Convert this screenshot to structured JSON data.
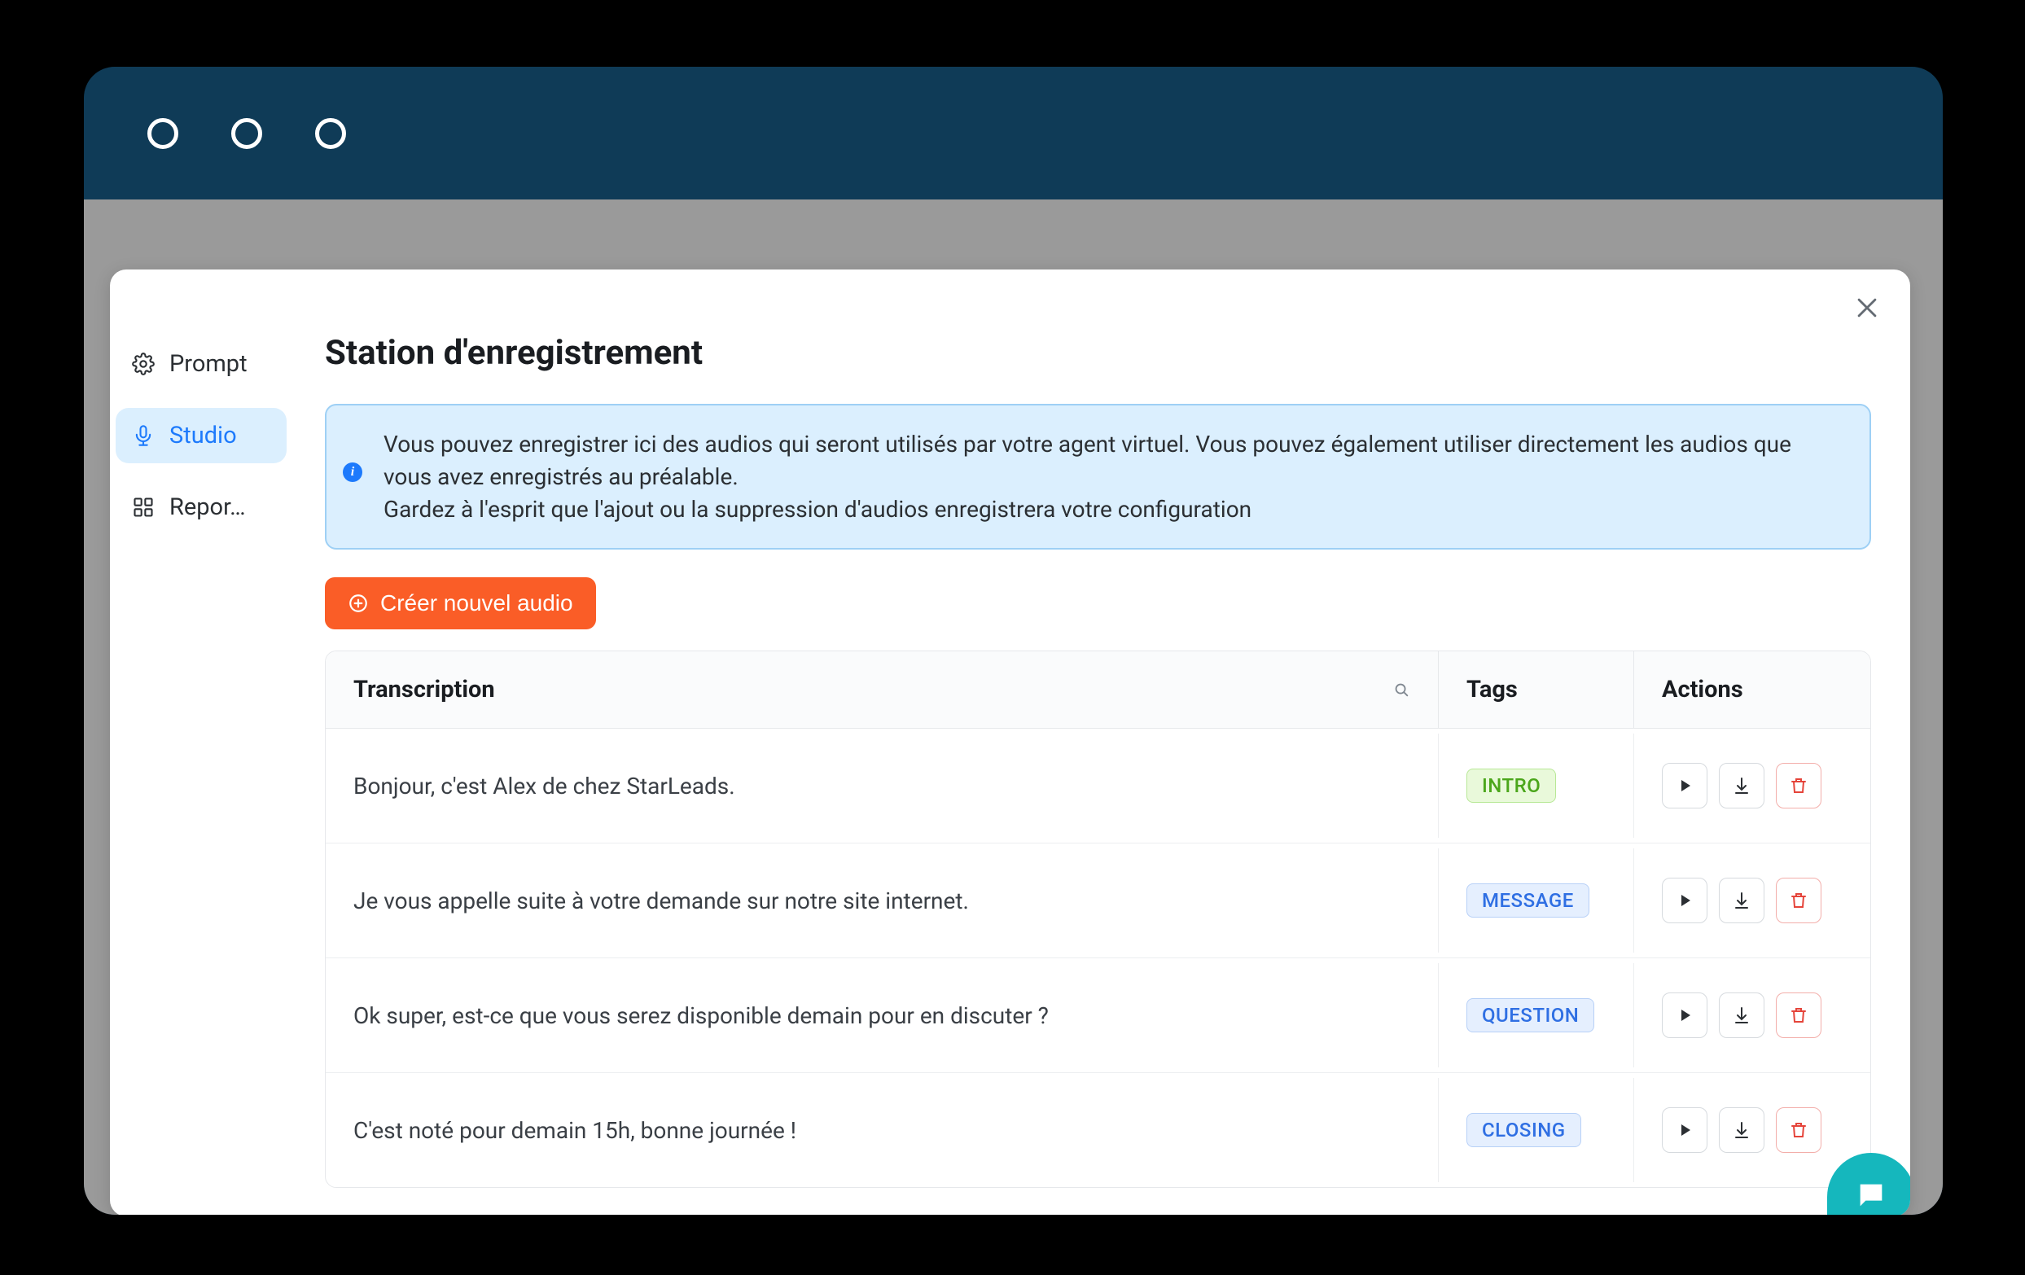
{
  "colors": {
    "titlebar": "#0f3b57",
    "accent": "#fa5d27",
    "link": "#1d7afc",
    "fab": "#15b7bd"
  },
  "sidebar": {
    "items": [
      {
        "key": "prompt",
        "label": "Prompt",
        "icon": "gear-icon"
      },
      {
        "key": "studio",
        "label": "Studio",
        "icon": "mic-icon",
        "active": true
      },
      {
        "key": "reporting",
        "label": "Repor…",
        "icon": "grid-icon"
      }
    ]
  },
  "header": {
    "title": "Station d'enregistrement"
  },
  "banner": {
    "line1": "Vous pouvez enregistrer ici des audios qui seront utilisés par votre agent virtuel. Vous pouvez également utiliser directement les audios que vous avez enregistrés au préalable.",
    "line2": "Gardez à l'esprit que l'ajout ou la suppression d'audios enregistrera votre configuration"
  },
  "buttons": {
    "create_audio": "Créer nouvel audio"
  },
  "table": {
    "columns": {
      "transcription": "Transcription",
      "tags": "Tags",
      "actions": "Actions"
    },
    "rows": [
      {
        "text": "Bonjour, c'est Alex de chez StarLeads.",
        "tag": "INTRO",
        "tag_style": "green"
      },
      {
        "text": "Je vous appelle suite à votre demande sur notre site internet.",
        "tag": "MESSAGE",
        "tag_style": "blue"
      },
      {
        "text": "Ok super, est-ce que vous serez disponible demain pour en discuter ?",
        "tag": "QUESTION",
        "tag_style": "blue"
      },
      {
        "text": "C'est noté pour demain 15h, bonne journée !",
        "tag": "CLOSING",
        "tag_style": "blue"
      }
    ]
  }
}
